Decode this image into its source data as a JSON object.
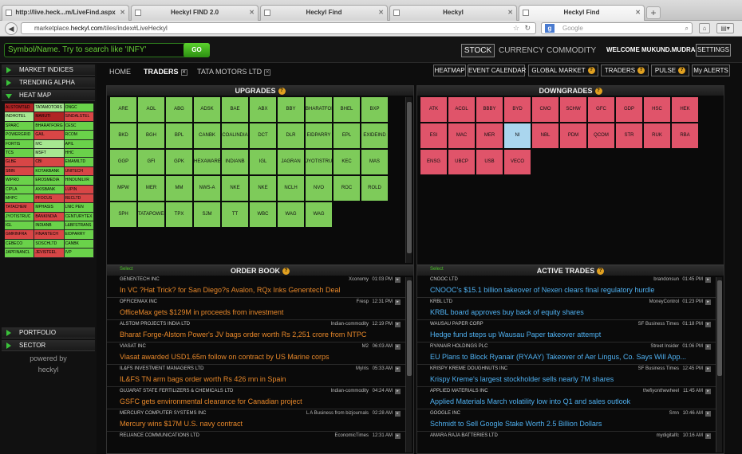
{
  "browser": {
    "tabs": [
      {
        "label": "http://live.heck...m/LiveFind.aspx"
      },
      {
        "label": "Heckyl FIND 2.0"
      },
      {
        "label": "Heckyl Find"
      },
      {
        "label": "Heckyl"
      },
      {
        "label": "Heckyl Find"
      }
    ],
    "url_prefix": "marketplace.",
    "url_host": "heckyl.com",
    "url_path": "/tiles/index#LiveHeckyl",
    "search_placeholder": "Google"
  },
  "header": {
    "search_placeholder": "Symbol/Name. Try to search like 'INFY'",
    "go_label": "GO",
    "market_tabs": [
      "STOCK",
      "CURRENCY",
      "COMMODITY"
    ],
    "welcome": "WELCOME MUKUND.MUDRAS",
    "settings_label": "SETTINGS"
  },
  "sidebar": {
    "sections": [
      "MARKET INDICES",
      "TRENDING ALPHA",
      "HEAT MAP",
      "PORTFOLIO",
      "SECTOR"
    ],
    "heatmap": [
      {
        "t": "ALSTOMT&D",
        "c": "dr"
      },
      {
        "t": "TATAMOTORS",
        "c": "lg"
      },
      {
        "t": "ONGC",
        "c": "g"
      },
      {
        "t": "INDHOTEL",
        "c": "lg"
      },
      {
        "t": "MARUTI",
        "c": "dr"
      },
      {
        "t": "SINDALSTEL",
        "c": "r"
      },
      {
        "t": "SPARC",
        "c": "g"
      },
      {
        "t": "BHARATFORG",
        "c": "g"
      },
      {
        "t": "CESC",
        "c": "g"
      },
      {
        "t": "POWERGRID",
        "c": "g"
      },
      {
        "t": "GAIL",
        "c": "r"
      },
      {
        "t": "RCOM",
        "c": "g"
      },
      {
        "t": "FORTIS",
        "c": "g"
      },
      {
        "t": "IVC",
        "c": "lg"
      },
      {
        "t": "APIL",
        "c": "g"
      },
      {
        "t": "TCS",
        "c": "g"
      },
      {
        "t": "MSFT",
        "c": "lg"
      },
      {
        "t": "HHC",
        "c": "g"
      },
      {
        "t": "GLBE",
        "c": "r"
      },
      {
        "t": "CBI",
        "c": "r"
      },
      {
        "t": "EMAMILTD",
        "c": "g"
      },
      {
        "t": "SBIN",
        "c": "r"
      },
      {
        "t": "KOTAKBANK",
        "c": "g"
      },
      {
        "t": "UNITECH",
        "c": "r"
      },
      {
        "t": "WIPRO",
        "c": "g"
      },
      {
        "t": "EROSMEDIA",
        "c": "g"
      },
      {
        "t": "HINDUNILVR",
        "c": "g"
      },
      {
        "t": "CIPLA",
        "c": "g"
      },
      {
        "t": "AXISBANK",
        "c": "g"
      },
      {
        "t": "LUPIN",
        "c": "r"
      },
      {
        "t": "MHPC",
        "c": "g"
      },
      {
        "t": "PFOCUS",
        "c": "r"
      },
      {
        "t": "RECLTD",
        "c": "r"
      },
      {
        "t": "TATACHEM",
        "c": "r"
      },
      {
        "t": "MPHASIS",
        "c": "g"
      },
      {
        "t": "LNIC PEN",
        "c": "g"
      },
      {
        "t": "JYOTISTRUC",
        "c": "g"
      },
      {
        "t": "BANKINDIA",
        "c": "r"
      },
      {
        "t": "CENTURYTEX",
        "c": "g"
      },
      {
        "t": "IGL",
        "c": "g"
      },
      {
        "t": "INDIANB",
        "c": "g"
      },
      {
        "t": "L&BFSTRANS",
        "c": "g"
      },
      {
        "t": "GMRINFRA",
        "c": "r"
      },
      {
        "t": "FINANTECH",
        "c": "r"
      },
      {
        "t": "EIDPARRY",
        "c": "g"
      },
      {
        "t": "CEBECO",
        "c": "g"
      },
      {
        "t": "SOSCHLTD",
        "c": "g"
      },
      {
        "t": "CANBK",
        "c": "g"
      },
      {
        "t": "JAPFINANCL",
        "c": "g"
      },
      {
        "t": "JEVISTEEL",
        "c": "r"
      },
      {
        "t": "IVP",
        "c": "g"
      }
    ],
    "powered_line1": "powered by",
    "powered_line2": "heckyl"
  },
  "subtabs": [
    {
      "label": "HOME",
      "closable": false
    },
    {
      "label": "TRADERS",
      "closable": true
    },
    {
      "label": "TATA MOTORS LTD",
      "closable": true
    }
  ],
  "right_buttons": [
    {
      "label": "HEATMAP",
      "info": false
    },
    {
      "label": "EVENT CALENDAR",
      "info": false
    },
    {
      "label": "GLOBAL MARKET",
      "info": true
    },
    {
      "label": "TRADERS",
      "info": true
    },
    {
      "label": "PULSE",
      "info": true
    },
    {
      "label": "My ALERTS",
      "info": false
    }
  ],
  "upgrades": {
    "title": "UPGRADES",
    "tiles": [
      "ARE",
      "AOL",
      "ABG",
      "ADSK",
      "BAE",
      "ABX",
      "BBY",
      "BHARATFOR",
      "BHEL",
      "BXP",
      "BKD",
      "BGH",
      "BPL",
      "CANBK",
      "COALINDIA",
      "DCT",
      "DLR",
      "EIDPARRY",
      "EPL",
      "EXIDEIND",
      "GGP",
      "GFI",
      "GPK",
      "HEXAWARE",
      "INDIANB",
      "IGL",
      "JAGRAN",
      "JYOTISTRUC",
      "KEC",
      "MAS",
      "MPW",
      "MER",
      "MM",
      "NWS-A",
      "NKE",
      "NKE",
      "NCLH",
      "NVO",
      "ROC",
      "ROLD",
      "SPH",
      "TATAPOWER",
      "TPX",
      "SJM",
      "TT",
      "WBC",
      "WAG",
      "WAG"
    ]
  },
  "downgrades": {
    "title": "DOWNGRADES",
    "tiles": [
      {
        "t": "ATK",
        "c": "r"
      },
      {
        "t": "ACGL",
        "c": "r"
      },
      {
        "t": "BBBY",
        "c": "r"
      },
      {
        "t": "BYD",
        "c": "r"
      },
      {
        "t": "CMO",
        "c": "r"
      },
      {
        "t": "SCHW",
        "c": "r"
      },
      {
        "t": "GFC",
        "c": "r"
      },
      {
        "t": "GDP",
        "c": "r"
      },
      {
        "t": "HSC",
        "c": "r"
      },
      {
        "t": "HEK",
        "c": "r"
      },
      {
        "t": "ESI",
        "c": "r"
      },
      {
        "t": "MAC",
        "c": "r"
      },
      {
        "t": "MER",
        "c": "r"
      },
      {
        "t": "NI",
        "c": "b"
      },
      {
        "t": "NBL",
        "c": "r"
      },
      {
        "t": "PDM",
        "c": "r"
      },
      {
        "t": "QCOM",
        "c": "r"
      },
      {
        "t": "STR",
        "c": "r"
      },
      {
        "t": "RUK",
        "c": "r"
      },
      {
        "t": "RBA",
        "c": "r"
      },
      {
        "t": "ENSG",
        "c": "r"
      },
      {
        "t": "UBCP",
        "c": "r"
      },
      {
        "t": "USB",
        "c": "r"
      },
      {
        "t": "VECO",
        "c": "r"
      }
    ]
  },
  "order_book": {
    "title": "ORDER BOOK",
    "select_label": "Select",
    "items": [
      {
        "company": "GENENTECH INC",
        "source": "Xconomy",
        "time": "01:03 PM",
        "headline": "In VC ?Hat Trick? for San Diego?s Avalon, RQx Inks Genentech Deal"
      },
      {
        "company": "OFFICEMAX INC",
        "source": "Fresp",
        "time": "12:31 PM",
        "headline": "OfficeMax gets $129M in proceeds from investment"
      },
      {
        "company": "ALSTOM PROJECTS INDIA LTD",
        "source": "Indian-commodity",
        "time": "12:19 PM",
        "headline": "Bharat Forge-Alstom Power's JV bags order worth Rs 2,251 crore from NTPC"
      },
      {
        "company": "VIASAT INC",
        "source": "M2",
        "time": "06:03 AM",
        "headline": "Viasat awarded USD1.65m follow on contract by US Marine corps"
      },
      {
        "company": "IL&FS INVESTMENT MANAGERS LTD",
        "source": "MyIris",
        "time": "05:33 AM",
        "headline": "IL&FS TN arm bags order worth Rs 426 mn in Spain"
      },
      {
        "company": "GUJARAT STATE FERTILIZERS & CHEMICALS LTD",
        "source": "Indian-commodity",
        "time": "04:24 AM",
        "headline": "GSFC gets environmental clearance for Canadian project"
      },
      {
        "company": "MERCURY COMPUTER SYSTEMS INC",
        "source": "L A Business from bizjournals",
        "time": "02:28 AM",
        "headline": "Mercury wins $17M U.S. navy contract"
      },
      {
        "company": "RELIANCE COMMUNICATIONS LTD",
        "source": "EconomicTimes",
        "time": "12:31 AM",
        "headline": ""
      }
    ]
  },
  "active_trades": {
    "title": "ACTIVE TRADES",
    "select_label": "Select",
    "items": [
      {
        "company": "CNOOC LTD",
        "source": "brandonsun",
        "time": "01:45 PM",
        "headline": "CNOOC's $15.1 billion takeover of Nexen clears final regulatory hurdle"
      },
      {
        "company": "KRBL LTD",
        "source": "MoneyControl",
        "time": "01:23 PM",
        "headline": "KRBL board approves buy back of equity shares"
      },
      {
        "company": "WAUSAU PAPER CORP",
        "source": "SF Business Times",
        "time": "01:18 PM",
        "headline": "Hedge fund steps up Wausau Paper takeover attempt"
      },
      {
        "company": "RYANAIR HOLDINGS PLC",
        "source": "Street Insider",
        "time": "01:06 PM",
        "headline": "EU Plans to Block Ryanair (RYAAY) Takeover of Aer Lingus, Co. Says Will App..."
      },
      {
        "company": "KRISPY KREME DOUGHNUTS INC",
        "source": "SF Business Times",
        "time": "12:45 PM",
        "headline": "Krispy Kreme's largest stockholder sells nearly 7M shares"
      },
      {
        "company": "APPLIED MATERIALS INC",
        "source": "thefiyonthewheel",
        "time": "11:45 AM",
        "headline": "Applied Materials March volatility low into Q1 and sales outlook"
      },
      {
        "company": "GOOGLE INC",
        "source": "Smn",
        "time": "10:46 AM",
        "headline": "Schmidt to Sell Google Stake Worth 2.5 Billion Dollars"
      },
      {
        "company": "AMARA RAJA BATTERIES LTD",
        "source": "mydigitalfc",
        "time": "10:16 AM",
        "headline": ""
      }
    ]
  },
  "colors": {
    "up": "#7ecb5a",
    "down": "#e0546a",
    "neutral": "#aad6ee",
    "accent": "#4ec62a",
    "headline_orange": "#e8882a",
    "headline_blue": "#4fb0f0"
  }
}
